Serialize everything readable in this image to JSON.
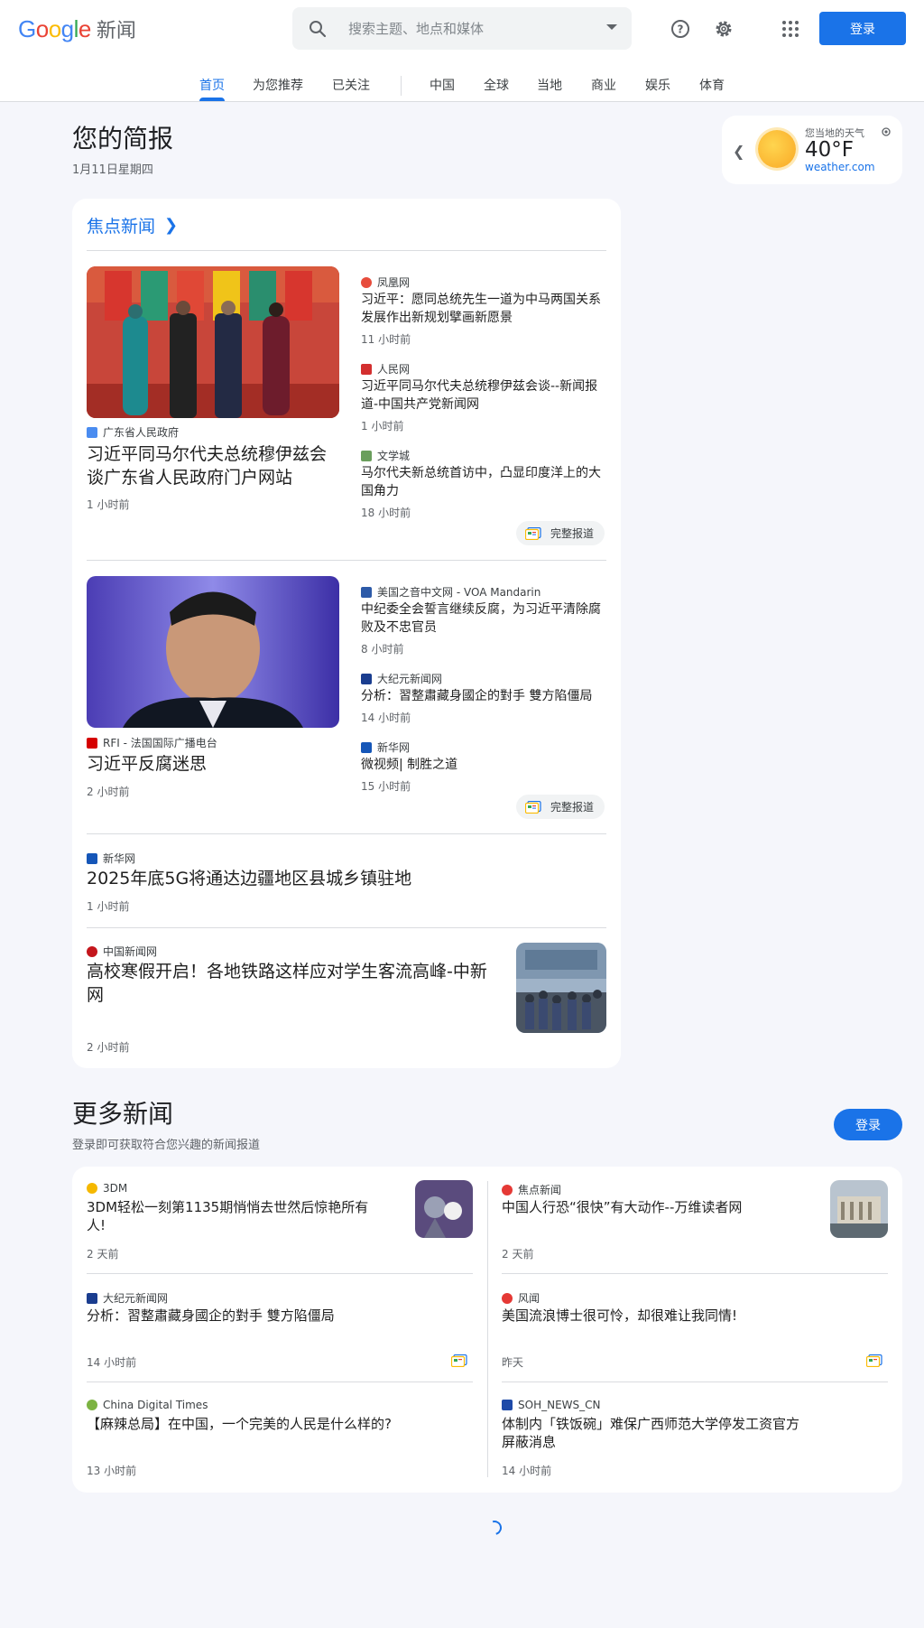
{
  "header": {
    "logo_brand": "Google",
    "logo_product": "新闻",
    "search_placeholder": "搜索主题、地点和媒体",
    "signin_label": "登录"
  },
  "nav": {
    "tabs": [
      "首页",
      "为您推荐",
      "已关注",
      "中国",
      "全球",
      "当地",
      "商业",
      "娱乐",
      "体育"
    ],
    "active": "首页"
  },
  "briefing": {
    "title": "您的简报",
    "date": "1月11日星期四"
  },
  "weather": {
    "label": "您当地的天气",
    "temp": "40°F",
    "source": "weather.com",
    "icon": "sun-icon"
  },
  "top_stories": {
    "section_label": "焦点新闻",
    "full_coverage_label": "完整报道",
    "cluster1": {
      "main": {
        "source": "广东省人民政府",
        "title": "习近平同马尔代夫总统穆伊兹会谈广东省人民政府门户网站",
        "time": "1 小时前"
      },
      "related": [
        {
          "source": "凤凰网",
          "title": "习近平：愿同总统先生一道为中马两国关系发展作出新规划擘画新愿景",
          "time": "11 小时前"
        },
        {
          "source": "人民网",
          "title": "习近平同马尔代夫总统穆伊兹会谈--新闻报道-中国共产党新闻网",
          "time": "1 小时前"
        },
        {
          "source": "文学城",
          "title": "马尔代夫新总统首访中，凸显印度洋上的大国角力",
          "time": "18 小时前"
        }
      ]
    },
    "cluster2": {
      "main": {
        "source": "RFI - 法国国际广播电台",
        "title": "习近平反腐迷思",
        "time": "2 小时前"
      },
      "related": [
        {
          "source": "美国之音中文网 - VOA Mandarin",
          "title": "中纪委全会誓言继续反腐，为习近平清除腐败及不忠官员",
          "time": "8 小时前"
        },
        {
          "source": "大纪元新闻网",
          "title": "分析：習整肅藏身國企的對手 雙方陷僵局",
          "time": "14 小时前"
        },
        {
          "source": "新华网",
          "title": "微视频| 制胜之道",
          "time": "15 小时前"
        }
      ]
    },
    "single1": {
      "source": "新华网",
      "title": "2025年底5G将通达边疆地区县城乡镇驻地",
      "time": "1 小时前"
    },
    "single2": {
      "source": "中国新闻网",
      "title": "高校寒假开启！各地铁路这样应对学生客流高峰-中新网",
      "time": "2 小时前"
    }
  },
  "more_news": {
    "title": "更多新闻",
    "subtitle": "登录即可获取符合您兴趣的新闻报道",
    "signin_label": "登录",
    "left": [
      {
        "source": "3DM",
        "title": "3DM轻松一刻第1135期悄悄去世然后惊艳所有人!",
        "time": "2 天前"
      },
      {
        "source": "大纪元新闻网",
        "title": "分析：習整肅藏身國企的對手 雙方陷僵局",
        "time": "14 小时前"
      },
      {
        "source": "China Digital Times",
        "title": "【麻辣总局】在中国，一个完美的人民是什么样的?",
        "time": "13 小时前"
      }
    ],
    "right": [
      {
        "source": "焦点新闻",
        "title": "中国人行恐“很快”有大动作--万维读者网",
        "time": "2 天前"
      },
      {
        "source": "风闻",
        "title": "美国流浪博士很可怜，却很难让我同情!",
        "time": "昨天"
      },
      {
        "source": "SOH_NEWS_CN",
        "title": "体制内「铁饭碗」难保广西师范大学停发工资官方屏蔽消息",
        "time": "14 小时前"
      }
    ]
  },
  "colors": {
    "accent": "#1a73e8",
    "background": "#f5f6fb",
    "card": "#ffffff"
  }
}
